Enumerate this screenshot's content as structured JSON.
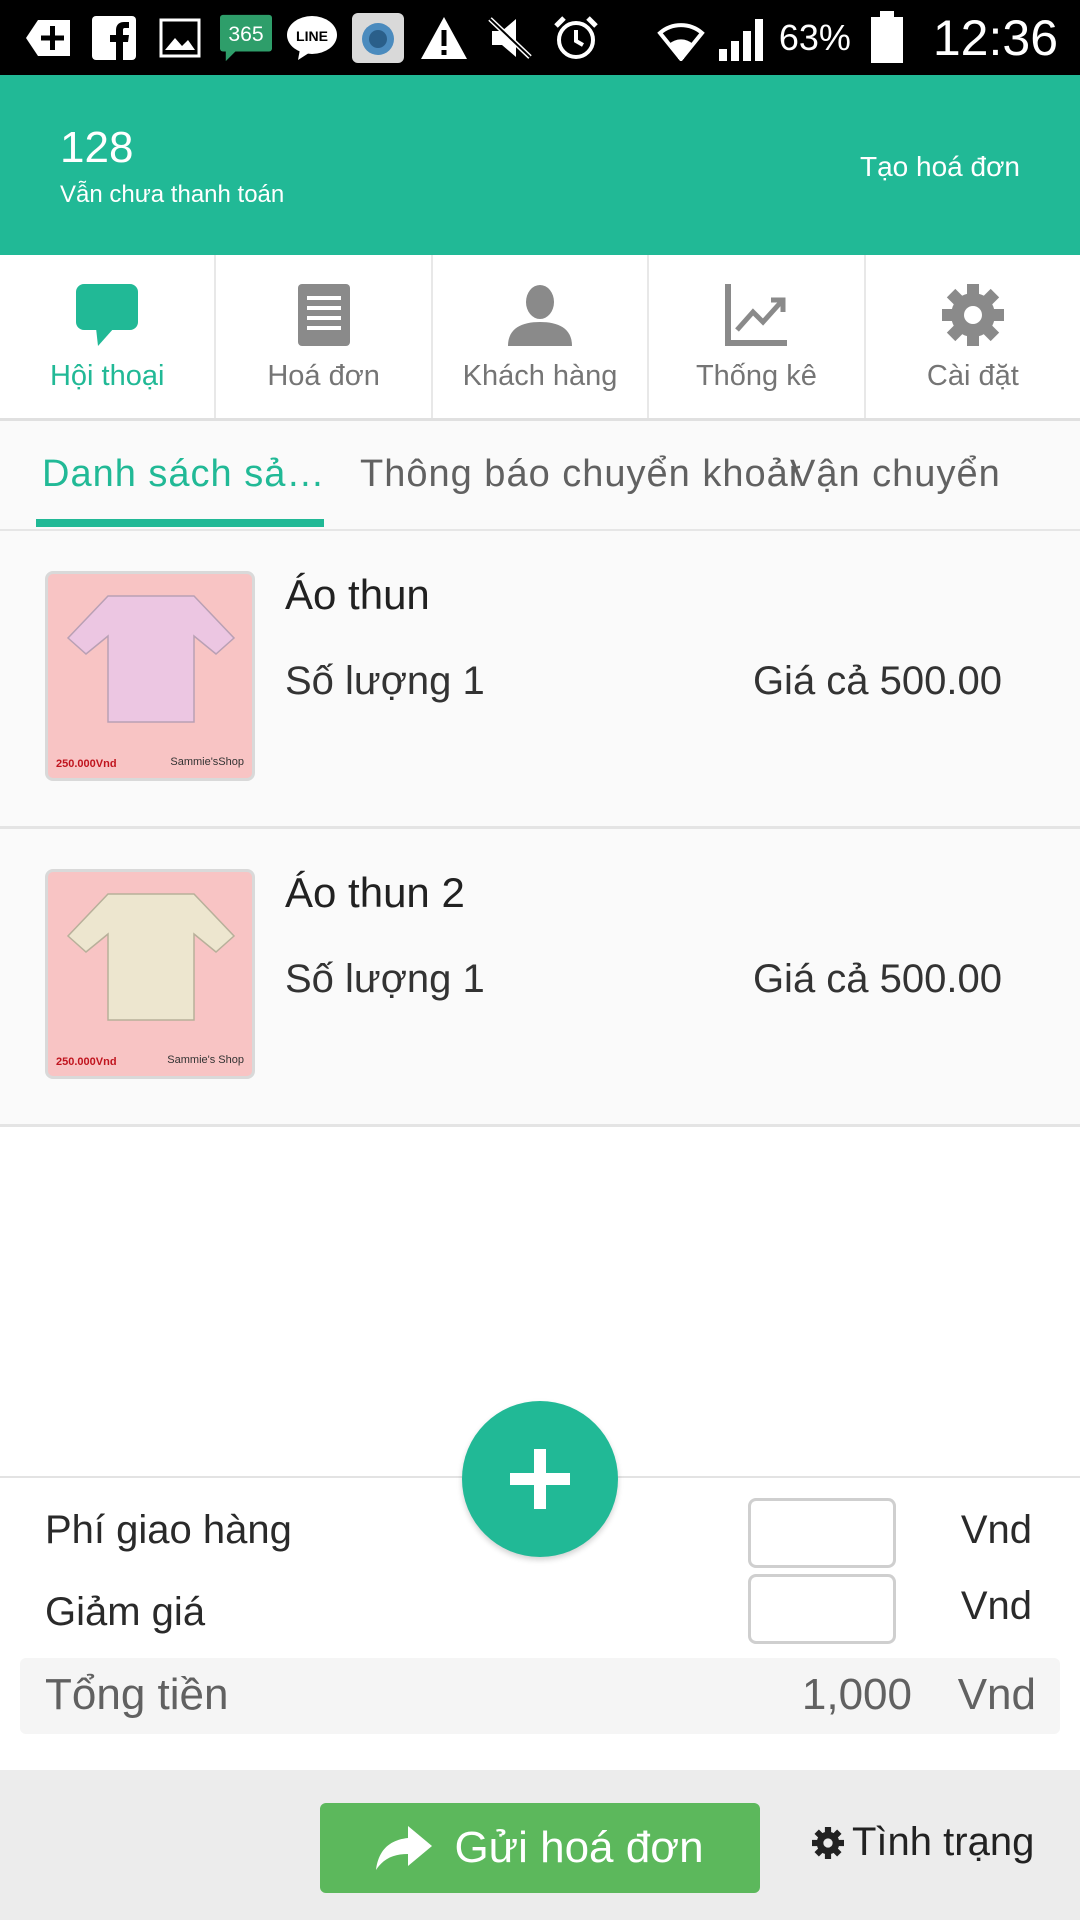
{
  "status_bar": {
    "icons": [
      "add-box-icon",
      "facebook-icon",
      "image-icon",
      "365-app-icon",
      "line-icon",
      "camera-app-icon",
      "warning-icon",
      "mute-icon",
      "alarm-icon",
      "wifi-icon",
      "signal-icon",
      "battery-icon"
    ],
    "app_badge": "365",
    "line_label": "LINE",
    "battery_percent": "63%",
    "time": "12:36"
  },
  "header": {
    "count": "128",
    "subtitle": "Vẫn chưa thanh toán",
    "create_invoice": "Tạo hoá đơn",
    "background": "#21b996"
  },
  "main_nav": {
    "items": [
      {
        "label": "Hội thoại",
        "icon": "chat-bubble-icon",
        "active": true
      },
      {
        "label": "Hoá đơn",
        "icon": "document-icon",
        "active": false
      },
      {
        "label": "Khách hàng",
        "icon": "person-icon",
        "active": false
      },
      {
        "label": "Thống kê",
        "icon": "chart-icon",
        "active": false
      },
      {
        "label": "Cài đặt",
        "icon": "gear-icon",
        "active": false
      }
    ]
  },
  "sub_tabs": {
    "items": [
      {
        "label": "Danh sách sả…",
        "active": true
      },
      {
        "label": "Thông báo chuyển khoản",
        "active": false
      },
      {
        "label": "Vận chuyển",
        "active": false
      }
    ]
  },
  "products": [
    {
      "name": "Áo thun",
      "quantity": "Số lượng 1",
      "price": "Giá cả 500.00",
      "thumb_price": "250.000Vnd",
      "thumb_shop": "Sammie'sShop",
      "shirt_color": "#ecc6e2"
    },
    {
      "name": "Áo thun 2",
      "quantity": "Số lượng 1",
      "price": "Giá cả 500.00",
      "thumb_price": "250.000Vnd",
      "thumb_shop": "Sammie's Shop",
      "shirt_color": "#ede6cf"
    }
  ],
  "summary": {
    "shipping_label": "Phí giao hàng",
    "shipping_value": "",
    "shipping_unit": "Vnd",
    "discount_label": "Giảm giá",
    "discount_value": "",
    "discount_unit": "Vnd",
    "total_label": "Tổng tiền",
    "total_value": "1,000",
    "total_unit": "Vnd"
  },
  "actions": {
    "send_invoice": "Gửi hoá đơn",
    "status": "Tình trạng",
    "send_color": "#5cb85c"
  }
}
